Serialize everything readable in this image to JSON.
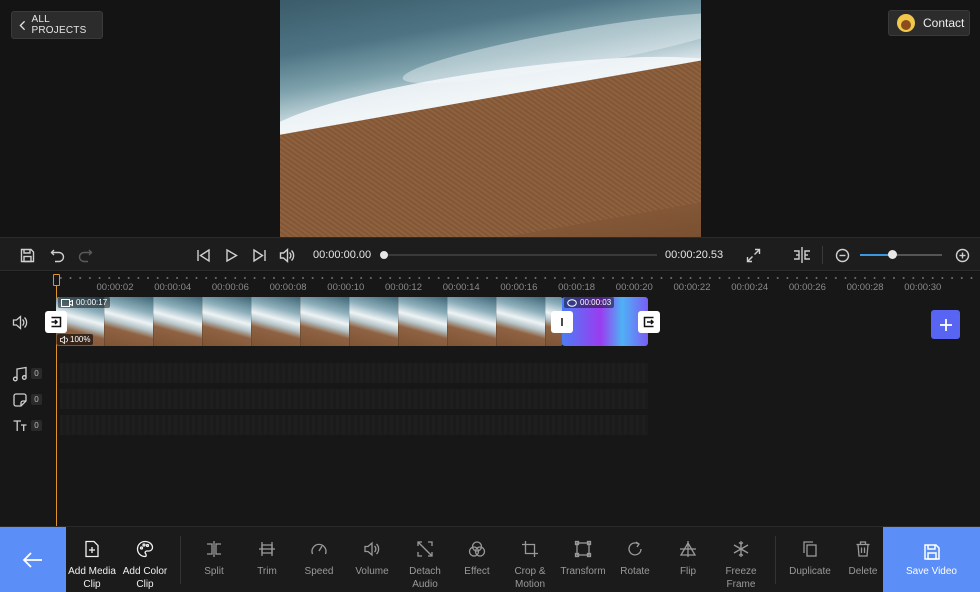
{
  "header": {
    "all_projects_label": "ALL PROJECTS",
    "contact_label": "Contact"
  },
  "player": {
    "current_time": "00:00:00.00",
    "total_time": "00:00:20.53",
    "seek_progress": 0,
    "zoom_level": 0.4
  },
  "timeline": {
    "ruler_labels": [
      "00:00:02",
      "00:00:04",
      "00:00:06",
      "00:00:08",
      "00:00:10",
      "00:00:12",
      "00:00:14",
      "00:00:16",
      "00:00:18",
      "00:00:20",
      "00:00:22",
      "00:00:24",
      "00:00:26",
      "00:00:28",
      "00:00:30"
    ],
    "video_clip": {
      "duration": "00:00:17",
      "volume": "100%"
    },
    "color_clip": {
      "duration": "00:00:03"
    },
    "tracks": [
      {
        "name": "music",
        "icon": "music-note-icon",
        "count": "0"
      },
      {
        "name": "sticker",
        "icon": "sticker-icon",
        "count": "0"
      },
      {
        "name": "text",
        "icon": "text-icon",
        "count": "0"
      }
    ]
  },
  "toolbar": {
    "add_media_clip": "Add Media Clip",
    "add_color_clip": "Add Color Clip",
    "split": "Split",
    "trim": "Trim",
    "speed": "Speed",
    "volume": "Volume",
    "detach_audio": "Detach Audio",
    "effect": "Effect",
    "crop_motion": "Crop & Motion",
    "transform": "Transform",
    "rotate": "Rotate",
    "flip": "Flip",
    "freeze_frame": "Freeze Frame",
    "duplicate": "Duplicate",
    "delete": "Delete",
    "save_video": "Save Video"
  },
  "colors": {
    "accent_blue": "#5c8ef7",
    "add_track_purple": "#5865f2",
    "playhead": "#e0932b",
    "zoom_fill": "#3a98e0"
  }
}
